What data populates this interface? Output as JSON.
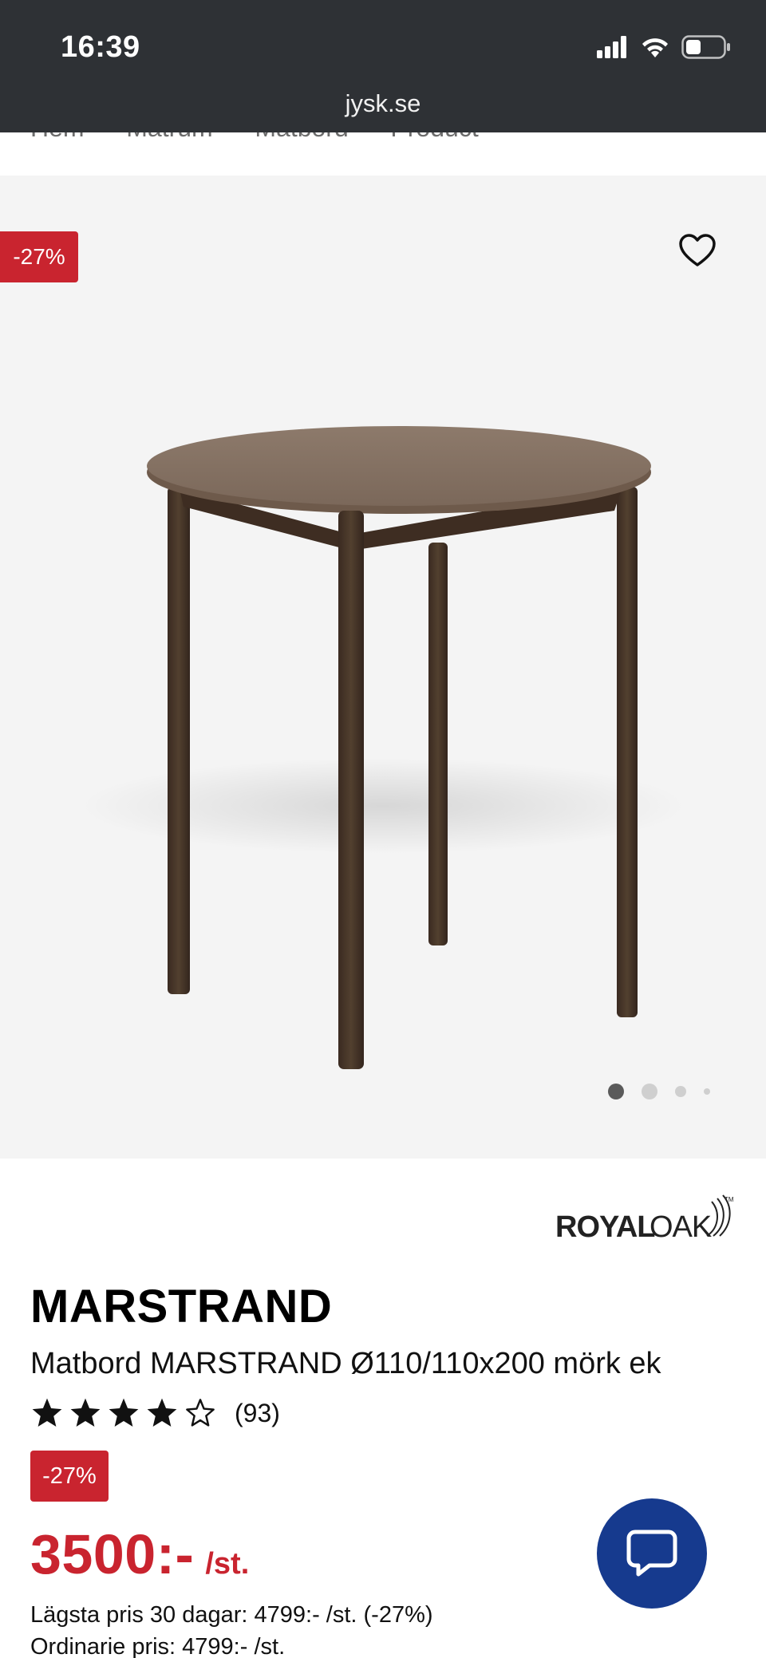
{
  "status_bar": {
    "time": "16:39",
    "url": "jysk.se",
    "icons": [
      "signal-icon",
      "wifi-icon",
      "battery-icon"
    ]
  },
  "breadcrumb": {
    "items": [
      "Hem",
      "Matrum",
      "Matbord",
      "Product"
    ]
  },
  "gallery": {
    "discount_badge": "-27%",
    "favorite_icon": "heart-icon",
    "image_description_icon": "dining-table-image",
    "slide_count": 4,
    "active_slide": 1
  },
  "product": {
    "brand": "ROYALOAK",
    "brand_trademark": "TM",
    "name": "MARSTRAND",
    "description": "Matbord MARSTRAND Ø110/110x200 mörk ek",
    "rating_value": 4.0,
    "rating_max": 5,
    "rating_count": "(93)",
    "discount_badge": "-27%",
    "price": "3500:-",
    "price_unit": "/st.",
    "lowest_price": "Lägsta pris 30 dagar: 4799:- /st. (-27%)",
    "regular_price": "Ordinarie pris: 4799:- /st."
  },
  "chat": {
    "icon": "chat-bubble-icon"
  },
  "colors": {
    "status_bar_bg": "#2e3135",
    "discount_red": "#c9242f",
    "price_red": "#c9242f",
    "chat_blue": "#163a8e",
    "gallery_bg": "#f4f4f4"
  }
}
